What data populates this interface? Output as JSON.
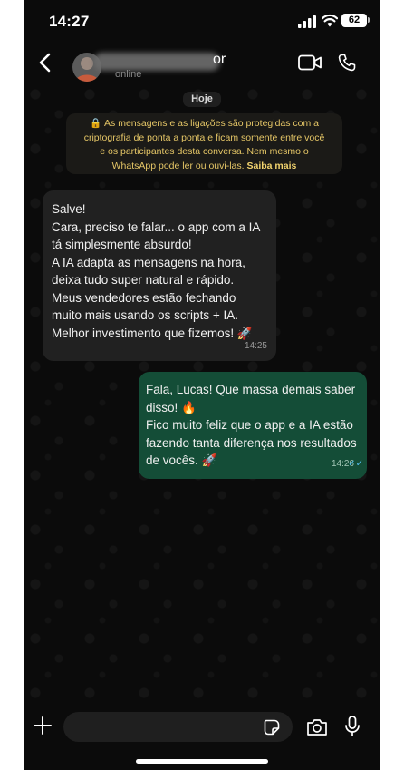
{
  "status_bar": {
    "time": "14:27",
    "battery": "62"
  },
  "header": {
    "name_visible_suffix": "or",
    "status": "online"
  },
  "chat": {
    "date_label": "Hoje",
    "encryption_notice": {
      "lines": [
        "As mensagens e as ligações são protegidas com a",
        "criptografia de ponta a ponta e ficam somente entre você",
        "e os participantes desta conversa. Nem mesmo o",
        "WhatsApp pode ler ou ouvi-las."
      ],
      "link": "Saiba mais"
    },
    "messages": [
      {
        "direction": "incoming",
        "lines": [
          "Salve!",
          "Cara, preciso te falar... o app com a IA",
          "tá simplesmente absurdo!",
          "A IA adapta as mensagens na hora,",
          "deixa tudo super natural e rápido.",
          "Meus vendedores estão fechando",
          "muito mais usando os scripts + IA.",
          "Melhor investimento que fizemos! 🚀"
        ],
        "time": "14:25"
      },
      {
        "direction": "outgoing",
        "lines": [
          "Fala, Lucas! Que massa demais saber",
          "disso! 🔥",
          "Fico muito feliz que o app e a IA estão",
          "fazendo tanta diferença nos resultados",
          "de vocês. 🚀"
        ],
        "time": "14:26",
        "ticks": "✓✓"
      }
    ]
  },
  "icons": {
    "back": "chevron-left-icon",
    "video": "video-camera-icon",
    "call": "phone-icon",
    "attach": "plus-icon",
    "sticker": "sticker-icon",
    "camera": "camera-icon",
    "mic": "microphone-icon",
    "lock": "lock-icon"
  },
  "colors": {
    "background": "#0b0b0b",
    "incoming_bubble": "#212121",
    "outgoing_bubble": "#144d37",
    "notice_text": "#e6c767",
    "read_ticks": "#53bdeb"
  }
}
